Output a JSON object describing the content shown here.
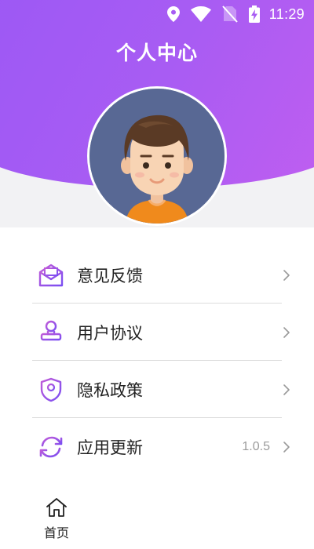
{
  "status_bar": {
    "time": "11:29",
    "icons": [
      "location-icon",
      "wifi-icon",
      "no-sim-icon",
      "battery-charging-icon"
    ]
  },
  "header": {
    "title": "个人中心",
    "gradient_colors": [
      "#9556f6",
      "#c15ef0"
    ]
  },
  "profile": {
    "avatar": "boy-avatar"
  },
  "menu": {
    "items": [
      {
        "label": "意见反馈",
        "icon": "feedback-mail-icon",
        "value": ""
      },
      {
        "label": "用户协议",
        "icon": "user-agreement-stamp-icon",
        "value": ""
      },
      {
        "label": "隐私政策",
        "icon": "privacy-shield-icon",
        "value": ""
      },
      {
        "label": "应用更新",
        "icon": "update-refresh-icon",
        "value": "1.0.5"
      }
    ]
  },
  "tabbar": {
    "items": [
      {
        "label": "首页",
        "icon": "home-icon"
      }
    ]
  },
  "colors": {
    "accent": "#9a4ff2",
    "text": "#222222",
    "muted": "#9a9a9a"
  }
}
